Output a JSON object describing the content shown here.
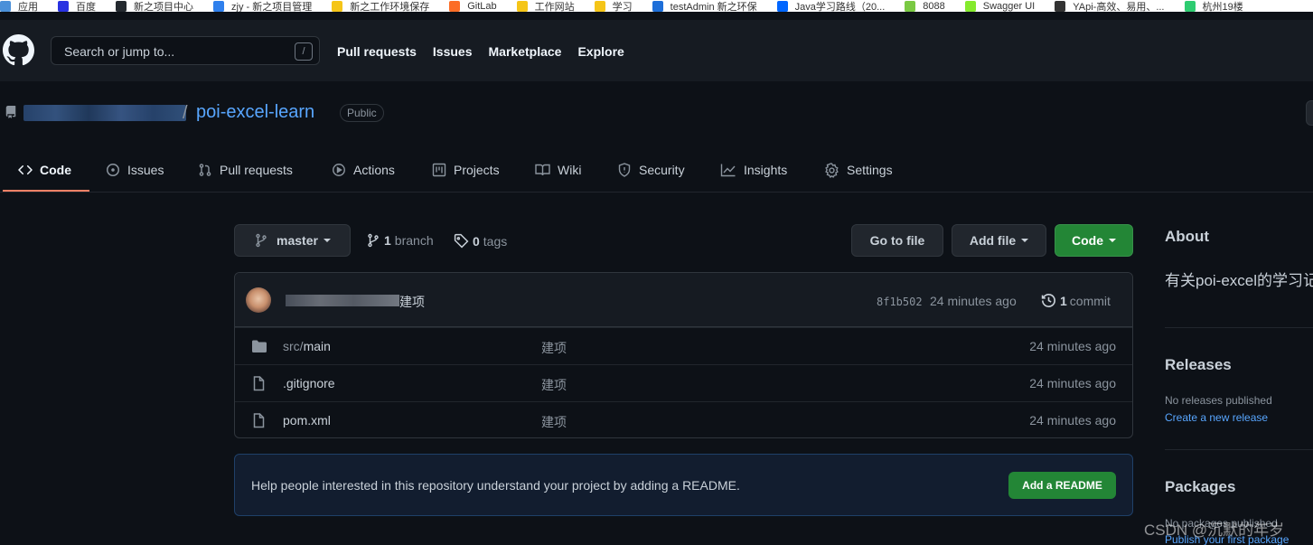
{
  "bookmarks": [
    {
      "label": "应用",
      "color": "#4a90d9"
    },
    {
      "label": "百度",
      "color": "#2932e1"
    },
    {
      "label": "新之项目中心",
      "color": "#24292f"
    },
    {
      "label": "zjy - 新之项目管理",
      "color": "#2f80ed"
    },
    {
      "label": "新之工作环境保存",
      "color": "#f5c518"
    },
    {
      "label": "GitLab",
      "color": "#fc6d26"
    },
    {
      "label": "工作网站",
      "color": "#f5c518"
    },
    {
      "label": "学习",
      "color": "#f5c518"
    },
    {
      "label": "testAdmin 新之环保",
      "color": "#1e6fd9"
    },
    {
      "label": "Java学习路线（20...",
      "color": "#0066ff"
    },
    {
      "label": "8088",
      "color": "#7ac943"
    },
    {
      "label": "Swagger UI",
      "color": "#85ea2d"
    },
    {
      "label": "YApi-高效、易用、...",
      "color": "#333333"
    },
    {
      "label": "杭州19楼",
      "color": "#2ecc71"
    }
  ],
  "header": {
    "search_placeholder": "Search or jump to...",
    "search_key": "/",
    "nav": [
      "Pull requests",
      "Issues",
      "Marketplace",
      "Explore"
    ]
  },
  "repo": {
    "name": "poi-excel-learn",
    "visibility": "Public",
    "separator": "/"
  },
  "tabs": [
    {
      "label": "Code",
      "icon": "code-icon"
    },
    {
      "label": "Issues",
      "icon": "issue-icon"
    },
    {
      "label": "Pull requests",
      "icon": "pull-request-icon"
    },
    {
      "label": "Actions",
      "icon": "play-icon"
    },
    {
      "label": "Projects",
      "icon": "project-icon"
    },
    {
      "label": "Wiki",
      "icon": "book-icon"
    },
    {
      "label": "Security",
      "icon": "shield-icon"
    },
    {
      "label": "Insights",
      "icon": "graph-icon"
    },
    {
      "label": "Settings",
      "icon": "gear-icon"
    }
  ],
  "branch_bar": {
    "branch": "master",
    "branch_count": "1",
    "branch_word": "branch",
    "tag_count": "0",
    "tag_word": "tags",
    "go_to_file": "Go to file",
    "add_file": "Add file",
    "code": "Code"
  },
  "commit": {
    "message": "建项",
    "sha": "8f1b502",
    "time": "24 minutes ago",
    "count": "1",
    "count_word": "commit"
  },
  "files": [
    {
      "type": "folder",
      "prefix": "src/",
      "name": "main",
      "message": "建项",
      "time": "24 minutes ago"
    },
    {
      "type": "file",
      "prefix": "",
      "name": ".gitignore",
      "message": "建项",
      "time": "24 minutes ago"
    },
    {
      "type": "file",
      "prefix": "",
      "name": "pom.xml",
      "message": "建项",
      "time": "24 minutes ago"
    }
  ],
  "readme": {
    "text": "Help people interested in this repository understand your project by adding a README.",
    "button": "Add a README"
  },
  "sidebar": {
    "about_title": "About",
    "about_text": "有关poi-excel的学习记",
    "releases_title": "Releases",
    "no_releases": "No releases published",
    "create_release": "Create a new release",
    "packages_title": "Packages",
    "no_packages": "No packages published",
    "publish_package": "Publish your first package"
  },
  "watermark": "CSDN @沉默的年岁",
  "colors": {
    "background": "#0d1117",
    "header": "#161b22",
    "link": "#58a6ff",
    "green": "#238636",
    "active_tab": "#f78166"
  }
}
